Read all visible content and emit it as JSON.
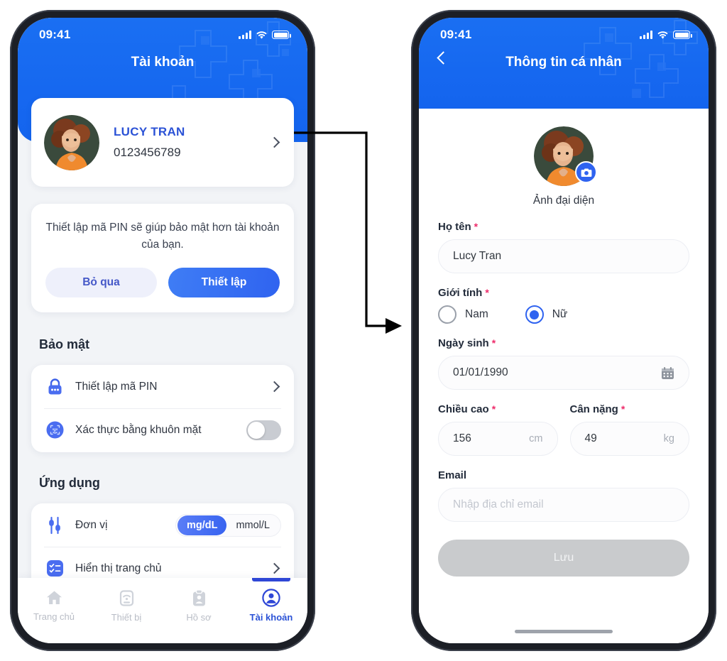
{
  "left_phone": {
    "status_bar": {
      "time": "09:41"
    },
    "header": {
      "title": "Tài khoản"
    },
    "profile": {
      "name": "LUCY TRAN",
      "phone": "0123456789",
      "chevron_icon": "chevron-right-icon",
      "avatar_icon": "user-avatar-photo"
    },
    "pin_promo": {
      "text": "Thiết lập mã PIN sẽ giúp bảo mật hơn tài khoản của bạn.",
      "skip_label": "Bỏ qua",
      "setup_label": "Thiết lập"
    },
    "security": {
      "section_title": "Bảo mật",
      "rows": [
        {
          "label": "Thiết lập mã PIN",
          "icon": "lock-icon",
          "trailing": "chevron-right-icon"
        },
        {
          "label": "Xác thực bằng khuôn mặt",
          "icon": "face-id-icon",
          "trailing": "toggle-switch-off"
        }
      ]
    },
    "application": {
      "section_title": "Ứng dụng",
      "unit_row": {
        "label": "Đơn vị",
        "icon": "sliders-icon",
        "options": [
          "mg/dL",
          "mmol/L"
        ],
        "selected": "mg/dL"
      },
      "home_row": {
        "label": "Hiển thị trang chủ",
        "icon": "checklist-icon",
        "trailing": "chevron-right-icon"
      }
    },
    "tabs": [
      {
        "label": "Trang chủ",
        "icon": "home-icon",
        "active": false
      },
      {
        "label": "Thiết bị",
        "icon": "device-wifi-icon",
        "active": false
      },
      {
        "label": "Hồ sơ",
        "icon": "clipboard-icon",
        "active": false
      },
      {
        "label": "Tài khoản",
        "icon": "account-circle-icon",
        "active": true
      }
    ]
  },
  "right_phone": {
    "status_bar": {
      "time": "09:41"
    },
    "header": {
      "title": "Thông tin cá nhân",
      "back_icon": "chevron-left-icon"
    },
    "avatar": {
      "caption": "Ảnh đại diện",
      "badge_icon": "camera-icon"
    },
    "form": {
      "name": {
        "label": "Họ tên",
        "required": "*",
        "value": "Lucy Tran"
      },
      "gender": {
        "label": "Giới tính",
        "required": "*",
        "options": [
          {
            "label": "Nam",
            "selected": false
          },
          {
            "label": "Nữ",
            "selected": true
          }
        ]
      },
      "dob": {
        "label": "Ngày sinh",
        "required": "*",
        "value": "01/01/1990",
        "icon": "calendar-icon"
      },
      "height": {
        "label": "Chiều cao",
        "required": "*",
        "value": "156",
        "unit": "cm"
      },
      "weight": {
        "label": "Cân nặng",
        "required": "*",
        "value": "49",
        "unit": "kg"
      },
      "email": {
        "label": "Email",
        "placeholder": "Nhập địa chỉ email",
        "value": ""
      },
      "save_label": "Lưu"
    }
  },
  "colors": {
    "brand_blue": "#1668f0",
    "accent_blue": "#2f63f0",
    "name_blue": "#2b52d6",
    "required_pink": "#ee2b6a",
    "toggle_off_gray": "#c9ccd2",
    "save_disabled_gray": "#c9cbcd"
  }
}
